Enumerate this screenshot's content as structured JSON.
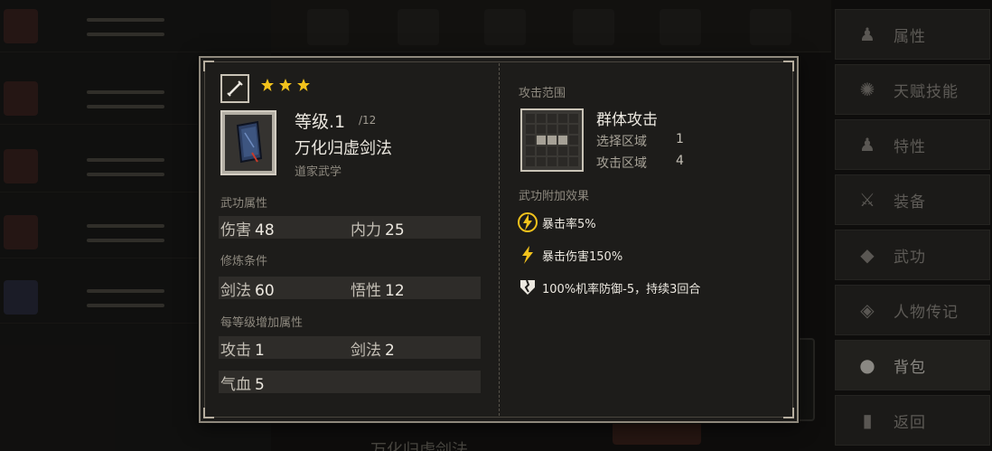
{
  "background": {
    "menu_items": [
      {
        "label": "属性",
        "icon": "person-icon"
      },
      {
        "label": "天赋技能",
        "icon": "talent-icon"
      },
      {
        "label": "特性",
        "icon": "trait-icon"
      },
      {
        "label": "装备",
        "icon": "equipment-icon"
      },
      {
        "label": "武功",
        "icon": "martial-arts-icon"
      },
      {
        "label": "人物传记",
        "icon": "biography-icon"
      },
      {
        "label": "背包",
        "icon": "bag-icon"
      },
      {
        "label": "返回",
        "icon": "back-icon"
      }
    ],
    "active_menu": "背包",
    "bottom_text": "万化归虚剑法"
  },
  "popup": {
    "type_icon": "sword-icon",
    "stars": 3,
    "star_color": "#f2c21c",
    "level_label": "等级.1",
    "level_max": "/12",
    "item_name": "万化归虚剑法",
    "item_category": "道家武学",
    "sections": {
      "attributes": "武功属性",
      "requirements": "修炼条件",
      "per_level": "每等级增加属性",
      "range": "攻击范围",
      "effects": "武功附加效果"
    },
    "attributes": [
      {
        "label": "伤害",
        "value": "48"
      },
      {
        "label": "内力",
        "value": "25"
      }
    ],
    "requirements": [
      {
        "label": "剑法",
        "value": "60"
      },
      {
        "label": "悟性",
        "value": "12"
      }
    ],
    "per_level": [
      {
        "label": "攻击",
        "value": "1"
      },
      {
        "label": "剑法",
        "value": "2"
      },
      {
        "label": "气血",
        "value": "5"
      }
    ],
    "range": {
      "type": "群体攻击",
      "select_label": "选择区域",
      "select_value": "1",
      "attack_label": "攻击区域",
      "attack_value": "4"
    },
    "effects": [
      {
        "icon": "lightning-circle-icon",
        "text": "暴击率5%"
      },
      {
        "icon": "lightning-icon",
        "text": "暴击伤害150%"
      },
      {
        "icon": "broken-shield-icon",
        "text": "100%机率防御-5，持续3回合"
      }
    ]
  }
}
